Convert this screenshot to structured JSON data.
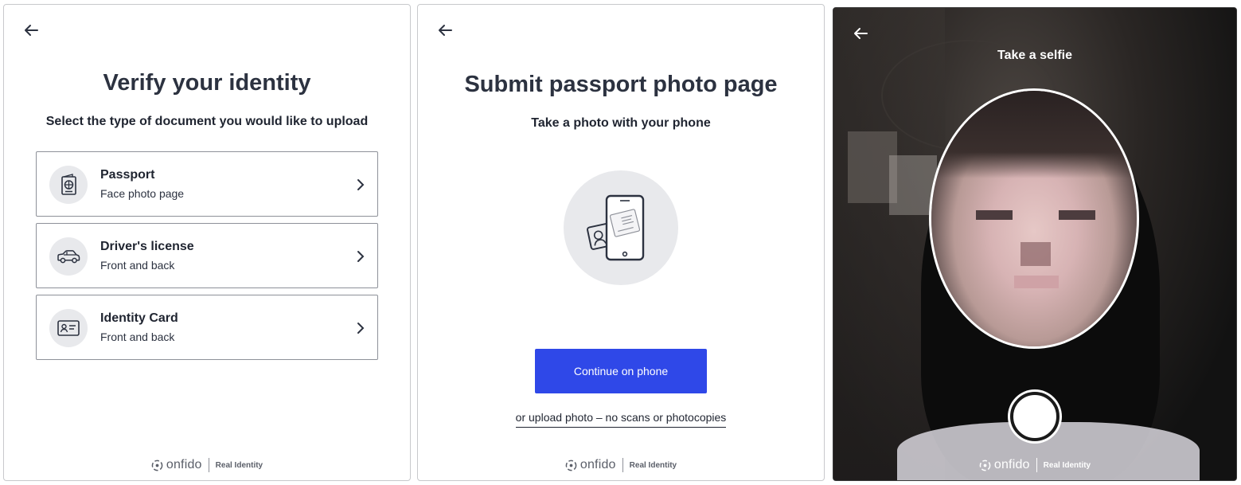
{
  "panel1": {
    "title": "Verify your identity",
    "subtitle": "Select the type of document you would like to upload",
    "options": [
      {
        "label": "Passport",
        "sub": "Face photo page",
        "icon": "passport-icon"
      },
      {
        "label": "Driver's license",
        "sub": "Front and back",
        "icon": "car-icon"
      },
      {
        "label": "Identity Card",
        "sub": "Front and back",
        "icon": "id-card-icon"
      }
    ]
  },
  "panel2": {
    "title": "Submit passport photo page",
    "subtitle": "Take a photo with your phone",
    "cta": "Continue on phone",
    "upload_link": "or upload photo – no scans or photocopies"
  },
  "panel3": {
    "title": "Take a selfie"
  },
  "footer": {
    "brand": "onfido",
    "tagline": "Real Identity"
  },
  "colors": {
    "primary_button": "#2f48e8",
    "text": "#2c3240",
    "icon_bg": "#e8e9ec"
  }
}
